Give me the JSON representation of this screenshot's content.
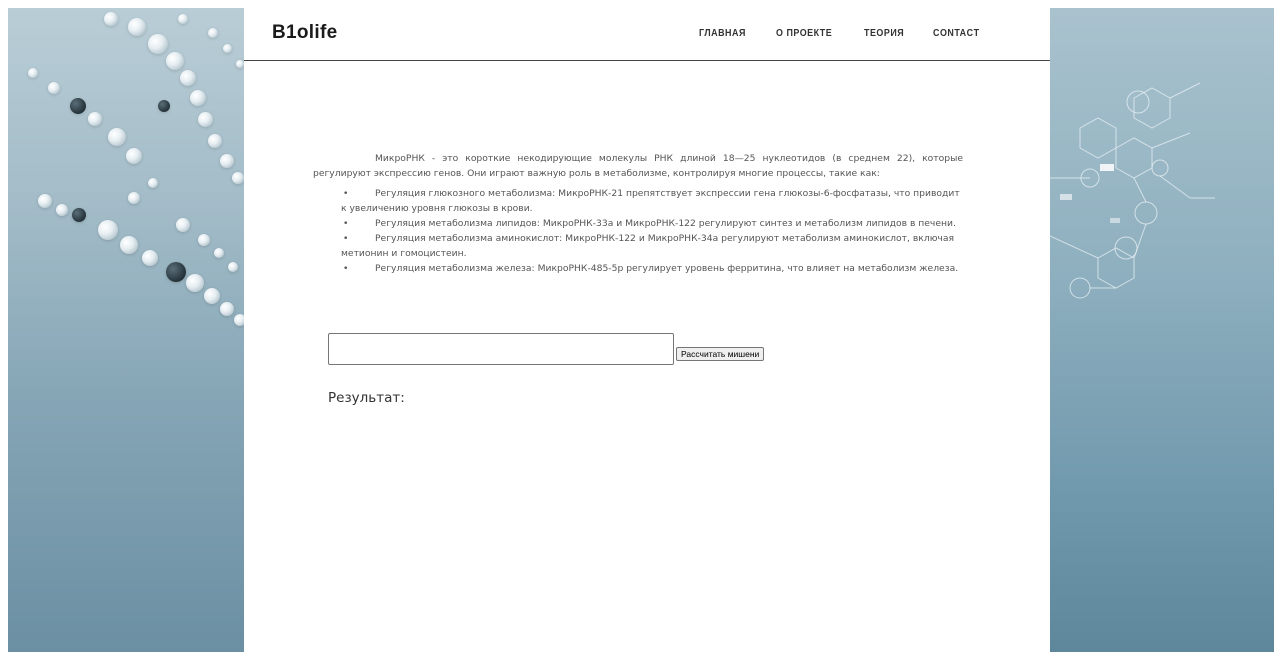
{
  "header": {
    "logo": "B1olife",
    "nav": [
      "ГЛАВНАЯ",
      "О ПРОЕКТЕ",
      "ТЕОРИЯ",
      "CONTACT"
    ]
  },
  "main": {
    "intro": "МикроРНК - это короткие некодирующие молекулы РНК длиной 18—25 нуклеотидов (в среднем 22), которые регулируют экспрессию генов. Они играют важную роль в метаболизме, контролируя многие процессы, такие как:",
    "items": [
      "Регуляция глюкозного метаболизма: МикроРНК-21 препятствует экспрессии гена глюкозы-6-фосфатазы, что приводит к увеличению уровня глюкозы в крови.",
      "Регуляция метаболизма липидов: МикроРНК-33а и МикроРНК-122 регулируют синтез и метаболизм липидов в печени.",
      "Регуляция метаболизма аминокислот: МикроРНК-122 и МикроРНК-34а регулируют метаболизм аминокислот, включая метионин и гомоцистеин.",
      "Регуляция метаболизма железа: МикроРНК-485-5р регулирует уровень ферритина, что влияет на метаболизм железа."
    ],
    "bullet": "•",
    "search": {
      "value": "",
      "button_label": "Рассчитать мишени"
    },
    "result_label": "Результат:"
  },
  "colors": {
    "left_panel": "#a3bcc8",
    "right_panel": "#8fb0bf",
    "text": "#555555"
  }
}
